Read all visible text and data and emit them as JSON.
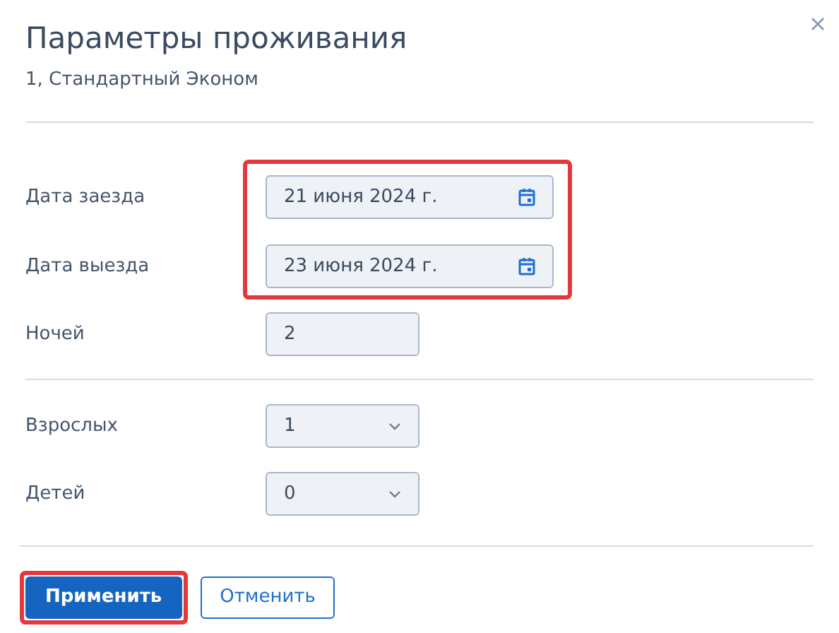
{
  "dialog": {
    "title": "Параметры проживания",
    "subtitle": "1, Стандартный Эконом"
  },
  "sections": [
    {
      "fields": [
        {
          "label": "Дата заезда",
          "kind": "date",
          "value": "21 июня 2024 г.",
          "highlighted": true
        },
        {
          "label": "Дата выезда",
          "kind": "date",
          "value": "23 июня 2024 г.",
          "highlighted": true
        },
        {
          "label": "Ночей",
          "kind": "number",
          "value": "2",
          "highlighted": false
        }
      ]
    },
    {
      "fields": [
        {
          "label": "Взрослых",
          "kind": "select",
          "value": "1",
          "highlighted": false
        },
        {
          "label": "Детей",
          "kind": "select",
          "value": "0",
          "highlighted": false
        }
      ]
    }
  ],
  "buttons": [
    {
      "label": "Применить",
      "kind": "primary",
      "highlighted": true
    },
    {
      "label": "Отменить",
      "kind": "secondary",
      "highlighted": false
    }
  ]
}
